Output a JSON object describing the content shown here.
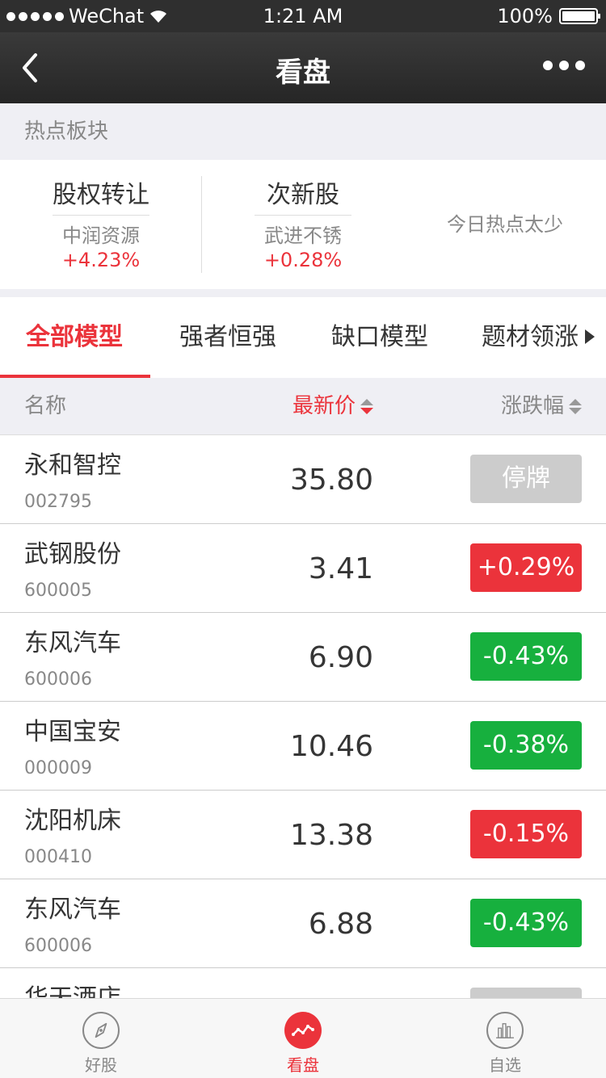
{
  "status_bar": {
    "carrier": "WeChat",
    "time": "1:21 AM",
    "battery": "100%"
  },
  "nav": {
    "title": "看盘"
  },
  "hot": {
    "title": "热点板块",
    "sectors": [
      {
        "name": "股权转让",
        "lead": "中润资源",
        "change": "+4.23%"
      },
      {
        "name": "次新股",
        "lead": "武进不锈",
        "change": "+0.28%"
      }
    ],
    "empty_text": "今日热点太少"
  },
  "tabs": [
    {
      "label": "全部模型",
      "active": true
    },
    {
      "label": "强者恒强",
      "active": false
    },
    {
      "label": "缺口模型",
      "active": false
    },
    {
      "label": "题材领涨",
      "active": false
    }
  ],
  "list_header": {
    "name": "名称",
    "price": "最新价",
    "change": "涨跌幅"
  },
  "stocks": [
    {
      "name": "永和智控",
      "code": "002795",
      "price": "35.80",
      "change": "停牌",
      "status": "halt"
    },
    {
      "name": "武钢股份",
      "code": "600005",
      "price": "3.41",
      "change": "+0.29%",
      "status": "up"
    },
    {
      "name": "东风汽车",
      "code": "600006",
      "price": "6.90",
      "change": "-0.43%",
      "status": "down"
    },
    {
      "name": "中国宝安",
      "code": "000009",
      "price": "10.46",
      "change": "-0.38%",
      "status": "down"
    },
    {
      "name": "沈阳机床",
      "code": "000410",
      "price": "13.38",
      "change": "-0.15%",
      "status": "up"
    },
    {
      "name": "东风汽车",
      "code": "600006",
      "price": "6.88",
      "change": "-0.43%",
      "status": "down"
    },
    {
      "name": "华天酒店",
      "code": "",
      "price": "",
      "change": "",
      "status": "halt"
    }
  ],
  "tabbar": [
    {
      "label": "好股",
      "icon": "compass-icon",
      "active": false
    },
    {
      "label": "看盘",
      "icon": "trend-line-icon",
      "active": true
    },
    {
      "label": "自选",
      "icon": "bar-chart-icon",
      "active": false
    }
  ],
  "colors": {
    "up": "#EB333B",
    "down": "#17B03E",
    "halt": "#CCCCCC",
    "text_primary": "#353535",
    "text_secondary": "#888888",
    "background": "#EFEFF4"
  }
}
